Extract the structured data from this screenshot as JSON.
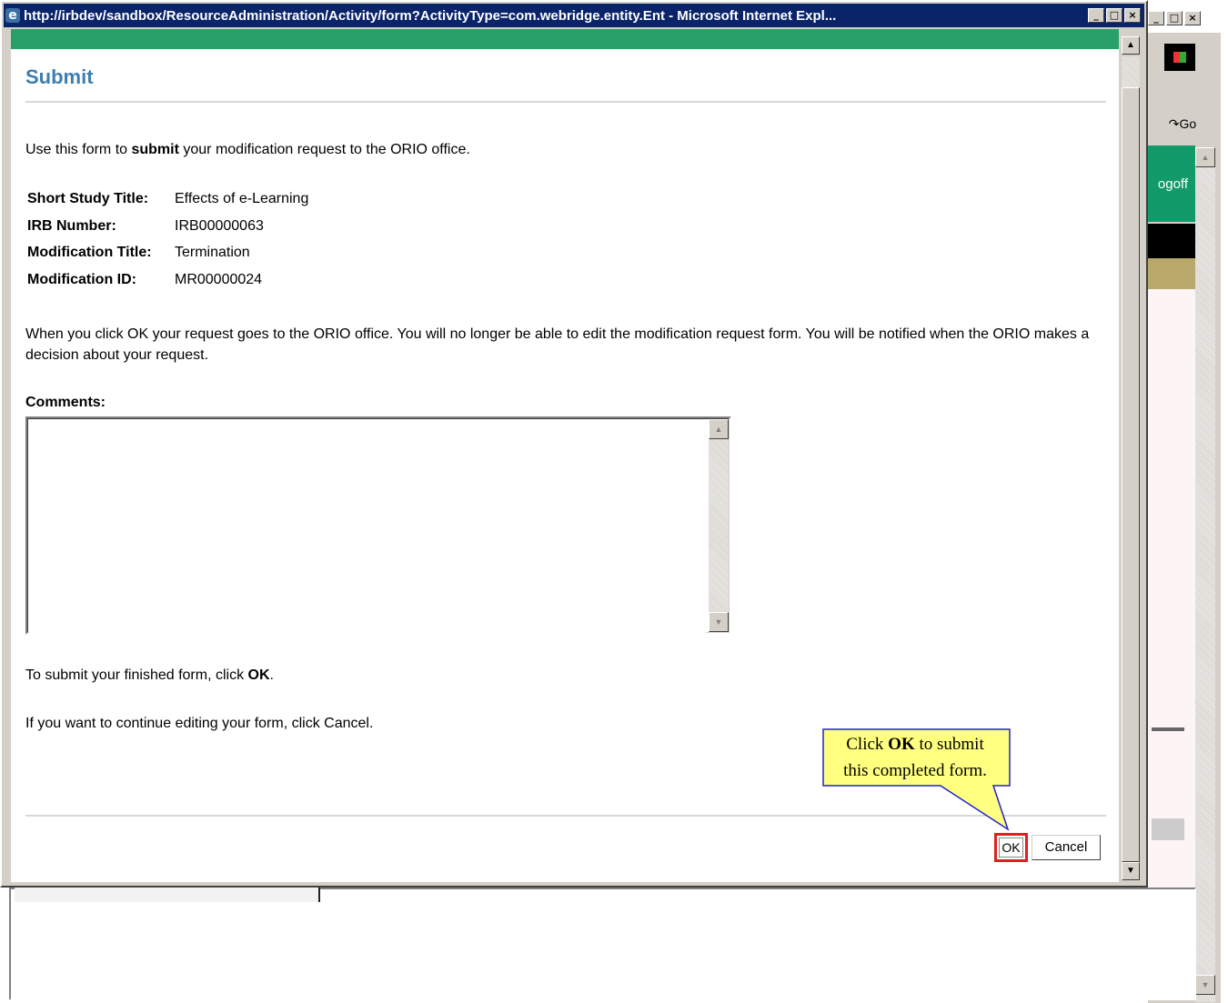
{
  "window": {
    "title": "http://irbdev/sandbox/ResourceAdministration/Activity/form?ActivityType=com.webridge.entity.Ent - Microsoft Internet Expl...",
    "minimize": "_",
    "maximize": "□",
    "close": "×"
  },
  "background": {
    "go_label": "Go",
    "logoff_label": "ogoff"
  },
  "form": {
    "heading": "Submit",
    "intro_prefix": "Use this form to ",
    "intro_bold": "submit",
    "intro_suffix": " your modification request to the ORIO office.",
    "fields": [
      {
        "label": "Short Study Title:",
        "value": "Effects of e-Learning"
      },
      {
        "label": "IRB Number:",
        "value": "IRB00000063"
      },
      {
        "label": "Modification Title:",
        "value": "Termination"
      },
      {
        "label": "Modification ID:",
        "value": "MR00000024"
      }
    ],
    "notice": "When you click OK your request goes to the ORIO office. You will no longer be able to edit the modification request form. You will be notified when the ORIO makes a decision about your request.",
    "comments_label": "Comments:",
    "comments_value": "",
    "instr1_prefix": "To submit your finished form, click ",
    "instr1_bold": "OK",
    "instr1_suffix": ".",
    "instr2": "If you want to continue editing your form, click Cancel.",
    "ok_label": "OK",
    "cancel_label": "Cancel"
  },
  "callout": {
    "line1_prefix": "Click ",
    "line1_bold": "OK",
    "line1_suffix": " to submit",
    "line2": "this completed form."
  },
  "colors": {
    "heading": "#3d7fb0",
    "titlebar": "#0a246a",
    "green_bar": "#28a068",
    "ok_highlight": "#e02020",
    "callout_fill": "#ffff80"
  }
}
